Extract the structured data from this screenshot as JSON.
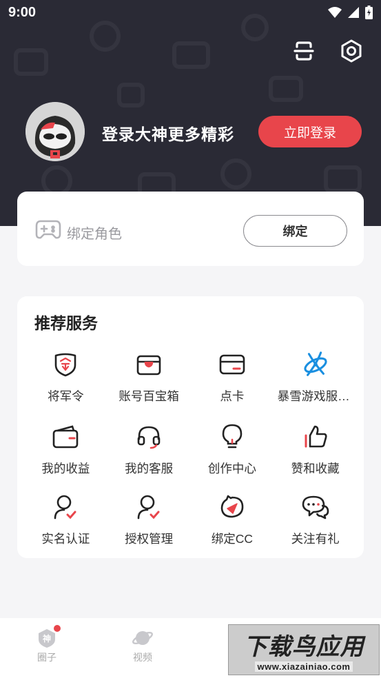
{
  "status_bar": {
    "time": "9:00"
  },
  "header": {
    "login_prompt": "登录大神更多精彩",
    "login_button": "立即登录",
    "icons": [
      "scan-icon",
      "settings-icon"
    ]
  },
  "bind_card": {
    "label": "绑定角色",
    "button": "绑定"
  },
  "services": {
    "title": "推荐服务",
    "items": [
      {
        "label": "将军令",
        "icon": "token-shield-icon"
      },
      {
        "label": "账号百宝箱",
        "icon": "treasure-box-icon"
      },
      {
        "label": "点卡",
        "icon": "card-icon"
      },
      {
        "label": "暴雪游戏服务中心",
        "icon": "battlenet-icon"
      },
      {
        "label": "我的收益",
        "icon": "wallet-icon"
      },
      {
        "label": "我的客服",
        "icon": "headset-icon"
      },
      {
        "label": "创作中心",
        "icon": "lightbulb-icon"
      },
      {
        "label": "赞和收藏",
        "icon": "thumbs-up-icon"
      },
      {
        "label": "实名认证",
        "icon": "user-verified-icon"
      },
      {
        "label": "授权管理",
        "icon": "user-authorize-icon"
      },
      {
        "label": "绑定CC",
        "icon": "cc-icon"
      },
      {
        "label": "关注有礼",
        "icon": "chat-gift-icon"
      }
    ]
  },
  "tabbar": {
    "tabs": [
      {
        "label": "圈子",
        "icon": "god-shield-icon"
      },
      {
        "label": "视频",
        "icon": "planet-icon"
      }
    ]
  },
  "watermark": {
    "line1": "下载鸟应用",
    "line2": "www.xiazainiao.com"
  },
  "colors": {
    "accent": "#e8454b",
    "header_bg": "#2a2a35",
    "page_bg": "#f5f5f7"
  }
}
